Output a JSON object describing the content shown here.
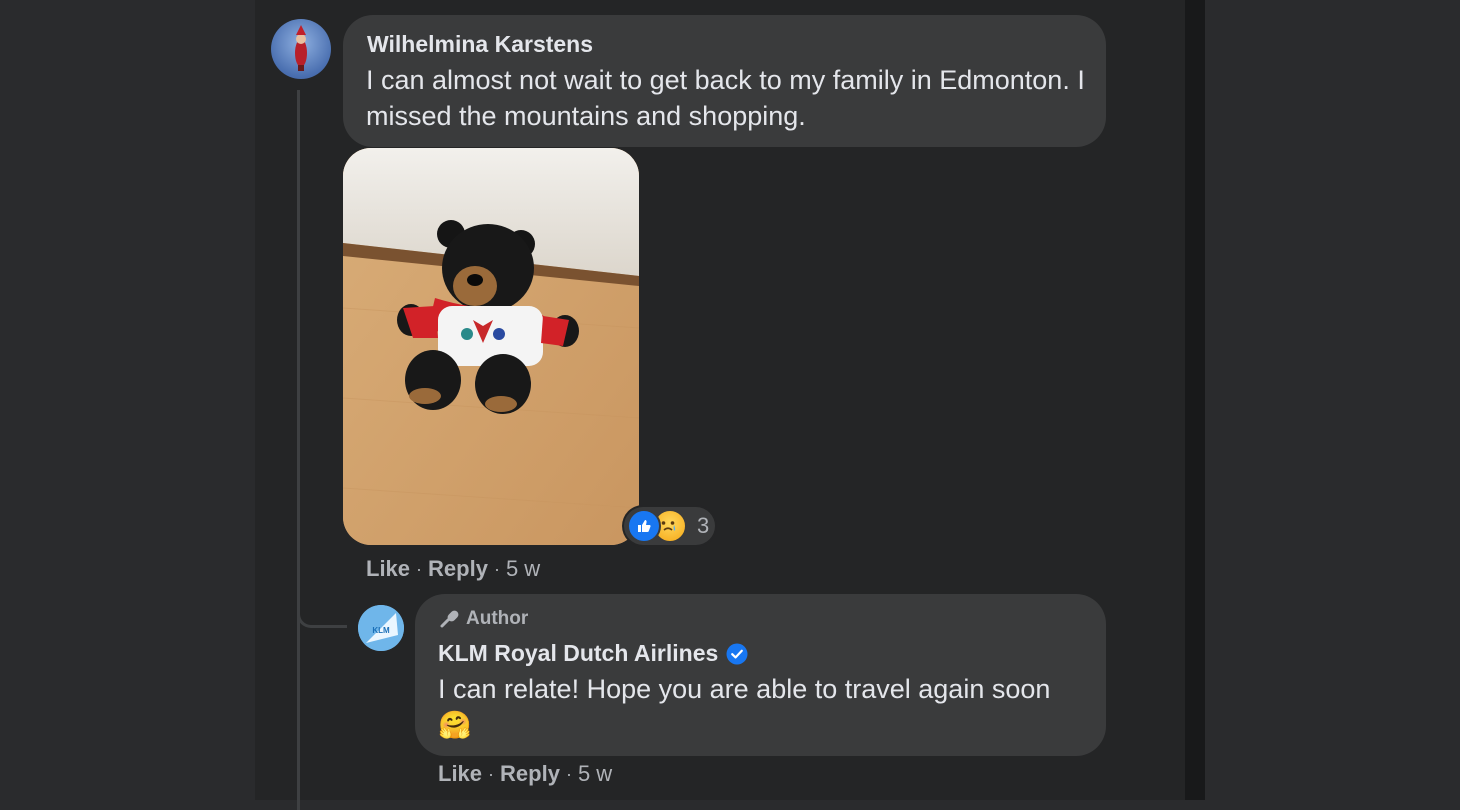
{
  "comments": [
    {
      "author": "Wilhelmina Karstens",
      "text": "I can almost not wait to get back to my family in Edmonton. I missed the mountains and shopping.",
      "attachment": {
        "type": "photo",
        "subject": "teddy-bear-icon"
      },
      "reactions": {
        "types": [
          "like",
          "sad"
        ],
        "count": "3"
      },
      "actions": {
        "like": "Like",
        "reply": "Reply",
        "time": "5 w"
      }
    },
    {
      "badge": "Author",
      "author": "KLM Royal Dutch Airlines",
      "verified": true,
      "text": "I can relate! Hope you are able to travel again soon",
      "emoji": "🤗",
      "actions": {
        "like": "Like",
        "reply": "Reply",
        "time": "5 w"
      }
    }
  ],
  "colors": {
    "background": "#242526",
    "bubble": "#3a3b3c",
    "text_primary": "#e4e6eb",
    "text_secondary": "#b0b3b8",
    "accent_blue": "#1877f2"
  }
}
